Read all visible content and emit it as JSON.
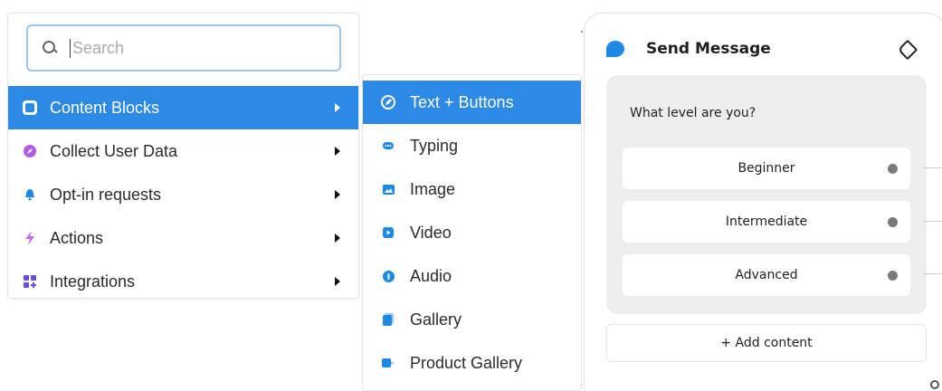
{
  "search": {
    "placeholder": "Search"
  },
  "menu": {
    "items": [
      {
        "label": "Content Blocks",
        "icon": "content-blocks-icon",
        "color": "#2d8ae4",
        "active": true
      },
      {
        "label": "Collect User Data",
        "icon": "compass-icon",
        "color": "#b05ce0"
      },
      {
        "label": "Opt-in requests",
        "icon": "bell-icon",
        "color": "#1e88e5"
      },
      {
        "label": "Actions",
        "icon": "lightning-icon",
        "color": "#c46ae8"
      },
      {
        "label": "Integrations",
        "icon": "grid-plus-icon",
        "color": "#6a4ad8"
      }
    ]
  },
  "submenu": {
    "items": [
      {
        "label": "Text + Buttons",
        "icon": "text-buttons-icon",
        "active": true
      },
      {
        "label": "Typing",
        "icon": "typing-icon"
      },
      {
        "label": "Image",
        "icon": "image-icon"
      },
      {
        "label": "Video",
        "icon": "video-icon"
      },
      {
        "label": "Audio",
        "icon": "audio-icon"
      },
      {
        "label": "Gallery",
        "icon": "gallery-icon"
      },
      {
        "label": "Product Gallery",
        "icon": "product-gallery-icon"
      }
    ]
  },
  "card": {
    "title": "Send Message",
    "question": "What level are you?",
    "buttons": [
      {
        "label": "Beginner"
      },
      {
        "label": "Intermediate"
      },
      {
        "label": "Advanced"
      }
    ],
    "add_content": "+ Add content"
  },
  "colors": {
    "accent": "#2d8ae4",
    "icon_blue": "#1e88e5"
  }
}
